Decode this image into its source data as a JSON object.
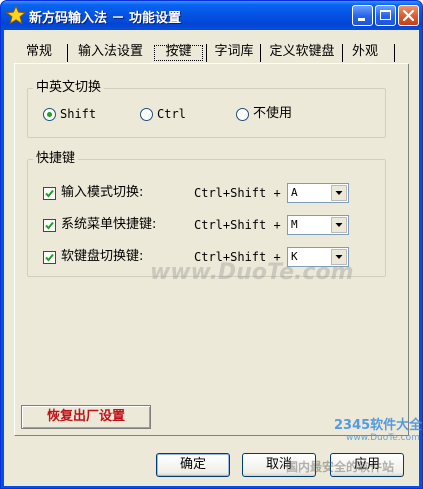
{
  "window": {
    "title": "新方码输入法 － 功能设置",
    "controls": {
      "minimize": "minimize",
      "maximize": "maximize",
      "close": "close"
    }
  },
  "tabs": [
    {
      "label": "常规",
      "selected": false
    },
    {
      "label": "输入法设置",
      "selected": false
    },
    {
      "label": "按键",
      "selected": true
    },
    {
      "label": "字词库",
      "selected": false
    },
    {
      "label": "定义软键盘",
      "selected": false
    },
    {
      "label": "外观",
      "selected": false
    }
  ],
  "lang_switch": {
    "title": "中英文切换",
    "options": [
      {
        "label": "Shift",
        "checked": true
      },
      {
        "label": "Ctrl",
        "checked": false
      },
      {
        "label": "不使用",
        "checked": false
      }
    ]
  },
  "hotkeys": {
    "title": "快捷键",
    "rows": [
      {
        "label": "输入模式切换:",
        "checked": true,
        "combo": "Ctrl+Shift +",
        "key": "A"
      },
      {
        "label": "系统菜单快捷键:",
        "checked": true,
        "combo": "Ctrl+Shift +",
        "key": "M"
      },
      {
        "label": "软键盘切换键:",
        "checked": true,
        "combo": "Ctrl+Shift +",
        "key": "K"
      }
    ]
  },
  "buttons": {
    "reset": "恢复出厂设置",
    "ok": "确定",
    "cancel": "取消",
    "apply": "应用"
  },
  "watermarks": {
    "center": "www.DuoTe.com",
    "corner_brand": "2345软件大全",
    "corner_url": "www.DuoTe.com",
    "corner_slogan": "国内最安全的软件站"
  },
  "colors": {
    "title_bar": "#0054e3",
    "dialog_bg": "#ece9d8",
    "reset_text": "#c1121a",
    "check_green": "#21a121"
  }
}
